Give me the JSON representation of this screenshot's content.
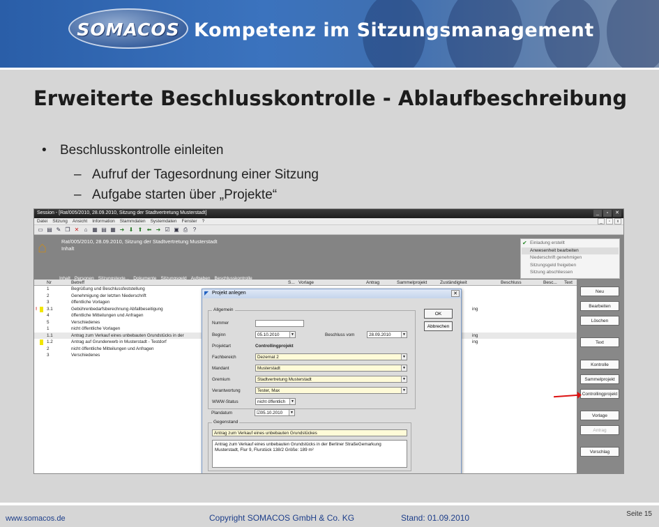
{
  "header": {
    "logo": "SOMACOS",
    "tagline": "Kompetenz im Sitzungsmanagement"
  },
  "title": "Erweiterte Beschlusskontrolle - Ablaufbeschreibung",
  "bullets": {
    "main": "Beschlusskontrolle einleiten",
    "subs": [
      "Aufruf der Tagesordnung einer Sitzung",
      "Aufgabe starten über „Projekte“"
    ]
  },
  "app": {
    "window_title": "Session - [Rat/005/2010, 28.09.2010, Sitzung der Stadtvertretung Musterstadt]",
    "menu": [
      "Datei",
      "Sitzung",
      "Ansicht",
      "Information",
      "Stammdaten",
      "Systemdaten",
      "Fenster",
      "?"
    ],
    "header_title": "Rat/005/2010, 28.09.2010, Sitzung der Stadtvertretung Musterstadt",
    "header_sub": "Inhalt",
    "links": [
      "Inhalt",
      "Personen",
      "Sitzungstexte...",
      "Dokumente",
      "Sitzungsgeld",
      "Aufgaben",
      "Beschlusskontrolle"
    ],
    "status": [
      "Einladung erstellt",
      "Anwesenheit bearbeiten",
      "Niederschrift genehmigen",
      "Sitzungsgeld freigeben",
      "Sitzung abschliessen"
    ],
    "columns": [
      "Nr",
      "Betreff",
      "S...",
      "Vorlage",
      "Antrag",
      "Sammelprojekt",
      "Zuständigkeit",
      "Beschluss",
      "Besc...",
      "Text"
    ],
    "rows": [
      {
        "nr": "1",
        "betreff": "Begrüßung und Beschlussfeststellung",
        "z": ""
      },
      {
        "nr": "2",
        "betreff": "Genehmigung der letzten Niederschrift",
        "z": ""
      },
      {
        "nr": "3",
        "betreff": "öffentliche Vorlagen",
        "z": ""
      },
      {
        "nr": "3.1",
        "betreff": "Gebührenbedarfsberechnung Abfallbeseitigung",
        "z": "ing"
      },
      {
        "nr": "4",
        "betreff": "öffentliche Mitteilungen und Anfragen",
        "z": ""
      },
      {
        "nr": "5",
        "betreff": "Verschiedenes",
        "z": ""
      },
      {
        "nr": "1",
        "betreff": "nicht öffentliche Vorlagen",
        "z": ""
      },
      {
        "nr": "1.1",
        "betreff": "Antrag zum Verkauf eines unbebauten  Grundstücks in der",
        "z": "ing"
      },
      {
        "nr": "1.2",
        "betreff": "Antrag auf Grunderwerb in Musterstadt - Testdorf",
        "z": "ing"
      },
      {
        "nr": "2",
        "betreff": "nicht öffentliche Mitteilungen und Anfragen",
        "z": ""
      },
      {
        "nr": "3",
        "betreff": "Verschiedenes",
        "z": ""
      }
    ],
    "buttons": [
      "Neu",
      "Bearbeiten",
      "Löschen",
      "Text",
      "Kontrolle",
      "Sammelprojekt",
      "Controllingprojekt",
      "Vorlage",
      "Antrag",
      "Vorschlag"
    ],
    "dialog": {
      "title": "Projekt anlegen",
      "group_general": "Allgemein",
      "labels": {
        "nummer": "Nummer",
        "beginn": "Beginn",
        "beschluss_vom": "Beschluss vom",
        "projektart": "Projektart",
        "fachbereich": "Fachbereich",
        "mandant": "Mandant",
        "gremium": "Gremium",
        "verantwortung": "Verantwortung",
        "www": "WWW-Status",
        "plandatum": "Plandatum"
      },
      "values": {
        "nummer": "",
        "beginn": "05.10.2010",
        "beschluss_vom": "28.09.2010",
        "projektart": "Controllingprojekt",
        "fachbereich": "Dezernat 2",
        "mandant": "Musterstadt",
        "gremium": "Stadtvertretung Musterstadt",
        "verantwortung": "Tester, Max",
        "www": "nicht öffentlich",
        "plandatum": "05.10.2010"
      },
      "ok": "OK",
      "cancel": "Abbrechen",
      "group_subject": "Gegenstand",
      "subject": "Antrag zum Verkauf eines unbebauten  Grundstückes",
      "subject_text_1": "Antrag zum Verkauf eines unbebauten  Grundstücks in der Berliner StraßeGemarkung",
      "subject_text_2": "Musterstadt,  Flur 9, Flurstück  138/2   Größe:  189 m²"
    }
  },
  "footer": {
    "url": "www.somacos.de",
    "copyright": "Copyright SOMACOS GmbH & Co. KG",
    "stand": "Stand: 01.09.2010",
    "page": "Seite 15"
  }
}
